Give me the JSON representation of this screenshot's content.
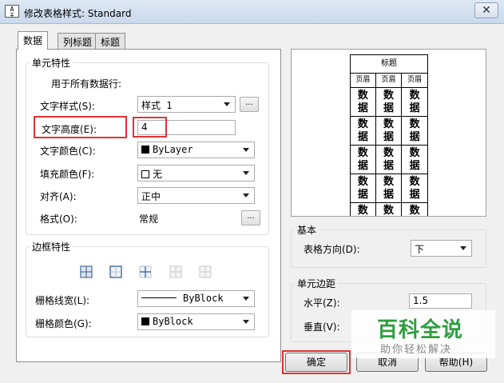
{
  "window": {
    "title": "修改表格样式: Standard",
    "close_glyph": "✕",
    "app_icon_text": "A̰ ∓"
  },
  "tabs": [
    {
      "label": "数据",
      "active": true
    },
    {
      "label": "列标题",
      "active": false
    },
    {
      "label": "标题",
      "active": false
    }
  ],
  "cell_props": {
    "legend": "单元特性",
    "applies_label": "用于所有数据行:",
    "text_style_label": "文字样式(S):",
    "text_style_value": "样式 1",
    "text_style_button": "...",
    "text_height_label": "文字高度(E):",
    "text_height_value": "4",
    "text_color_label": "文字颜色(C):",
    "text_color_value": "ByLayer",
    "text_color_swatch": "#000000",
    "fill_color_label": "填充颜色(F):",
    "fill_color_value": "无",
    "fill_color_swatch": "#ffffff",
    "align_label": "对齐(A):",
    "align_value": "正中",
    "format_label": "格式(O):",
    "format_value": "常规",
    "format_button": "..."
  },
  "border_props": {
    "legend": "边框特性",
    "lineweight_label": "栅格线宽(L):",
    "lineweight_value": "ByBlock",
    "color_label": "栅格颜色(G):",
    "color_value": "ByBlock",
    "color_swatch": "#000000"
  },
  "preview": {
    "title": "标题",
    "headers": [
      "页眉",
      "页眉",
      "页眉"
    ],
    "rows": [
      [
        "数\n据",
        "数\n据",
        "数\n据"
      ],
      [
        "数\n据",
        "数\n据",
        "数\n据"
      ],
      [
        "数\n据",
        "数\n据",
        "数\n据"
      ],
      [
        "数\n据",
        "数\n据",
        "数\n据"
      ],
      [
        "数\n据",
        "数\n据",
        "数\n据"
      ]
    ]
  },
  "basic": {
    "legend": "基本",
    "direction_label": "表格方向(D):",
    "direction_value": "下"
  },
  "margins": {
    "legend": "单元边距",
    "horizontal_label": "水平(Z):",
    "horizontal_value": "1.5",
    "vertical_label": "垂直(V):"
  },
  "buttons": {
    "ok": "确定",
    "cancel": "取消",
    "help": "帮助(H)"
  },
  "watermark": {
    "title": "百科全说",
    "subtitle": "助你轻松解决",
    "color": "#2e9e3f"
  }
}
